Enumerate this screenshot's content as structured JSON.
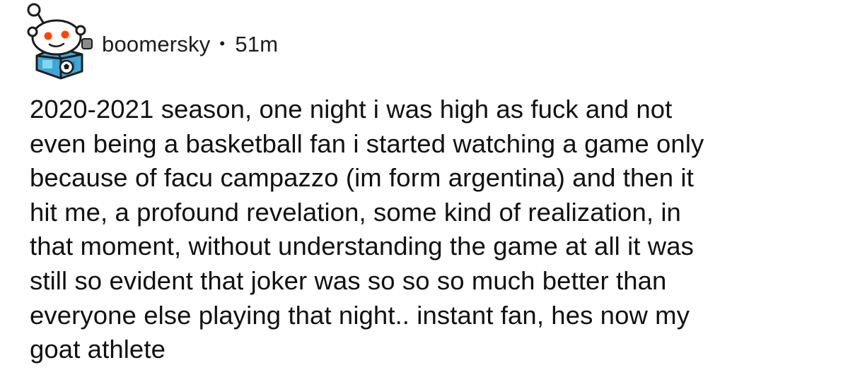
{
  "comment": {
    "author": "boomersky",
    "separator": "•",
    "age": "51m",
    "avatar_icon": "reddit-snoo-avatar-icon",
    "body_lines": [
      "2020-2021 season, one night i was high as fuck and not",
      "even being a basketball fan i started watching a game only",
      "because of facu campazzo (im form argentina) and then it",
      "hit me, a profound revelation, some kind of realization, in",
      "that moment, without understanding the game at all it was",
      "still so evident that joker was so so so much better than",
      "everyone else playing that night.. instant fan, hes now my",
      "goat athlete"
    ]
  },
  "colors": {
    "text": "#1c1c1c",
    "background": "#ffffff",
    "snoo_eye": "#ff4500",
    "avatar_bg": "#5cc9e8"
  }
}
